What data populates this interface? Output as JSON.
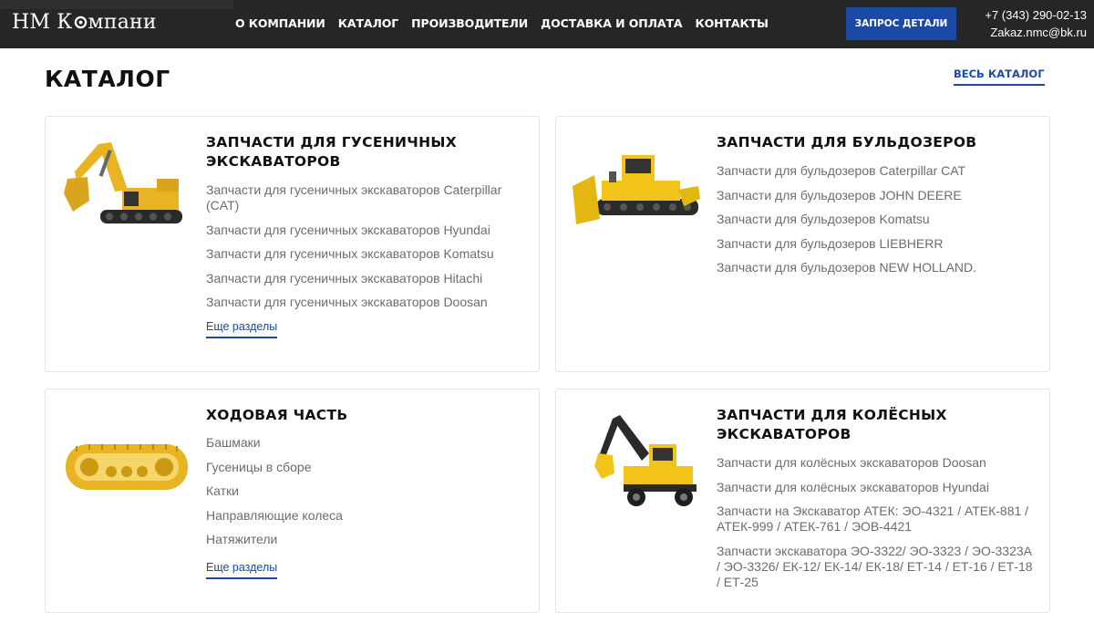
{
  "header": {
    "logo_left": "НМ К",
    "logo_right": "мпани",
    "nav": [
      "О КОМПАНИИ",
      "КАТАЛОГ",
      "ПРОИЗВОДИТЕЛИ",
      "ДОСТАВКА И ОПЛАТА",
      "КОНТАКТЫ"
    ],
    "request_button": "ЗАПРОС ДЕТАЛИ",
    "phone": "+7 (343) 290-02-13",
    "email": "Zakaz.nmc@bk.ru"
  },
  "page": {
    "title": "КАТАЛОГ",
    "all_catalog": "ВЕСЬ КАТАЛОГ"
  },
  "cards": [
    {
      "title": "ЗАПЧАСТИ ДЛЯ ГУСЕНИЧНЫХ ЭКСКАВАТОРОВ",
      "image": "tracked-excavator-image",
      "items": [
        "Запчасти для гусеничных экскаваторов Caterpillar (CAT)",
        "Запчасти для гусеничных экскаваторов Hyundai",
        "Запчасти для гусеничных экскаваторов Komatsu",
        "Запчасти для гусеничных экскаваторов Hitachi",
        "Запчасти для гусеничных экскаваторов Doosan"
      ],
      "more": "Еще разделы"
    },
    {
      "title": "ЗАПЧАСТИ ДЛЯ БУЛЬДОЗЕРОВ",
      "image": "bulldozer-image",
      "items": [
        "Запчасти для бульдозеров Caterpillar CAT",
        "Запчасти для бульдозеров JOHN DEERE",
        "Запчасти для бульдозеров Komatsu",
        "Запчасти для бульдозеров LIEBHERR",
        "Запчасти для бульдозеров NEW HOLLAND."
      ]
    },
    {
      "title": "ХОДОВАЯ ЧАСТЬ",
      "image": "undercarriage-image",
      "items": [
        "Башмаки",
        "Гусеницы в сборе",
        "Катки",
        "Направляющие колеса",
        "Натяжители"
      ],
      "more": "Еще разделы"
    },
    {
      "title": "ЗАПЧАСТИ ДЛЯ КОЛЁСНЫХ ЭКСКАВАТОРОВ",
      "image": "wheeled-excavator-image",
      "items": [
        "Запчасти для колёсных экскаваторов Doosan",
        "Запчасти для колёсных экскаваторов Hyundai",
        "Запчасти на Экскаватор АТЕК: ЭО-4321 / АТЕК-881 / АТЕК-999 / АТЕК-761 / ЭОВ-4421",
        "Запчасти экскаватора ЭО-3322/ ЭО-3323 / ЭО-3323А / ЭО-3326/ ЕК-12/ ЕК-14/ ЕК-18/ ЕТ-14 / ЕТ-16 / ЕТ-18 / ЕТ-25"
      ]
    }
  ],
  "colors": {
    "header_bg": "#262626",
    "accent": "#1b4aa6",
    "machine_yellow": "#f2c318"
  }
}
